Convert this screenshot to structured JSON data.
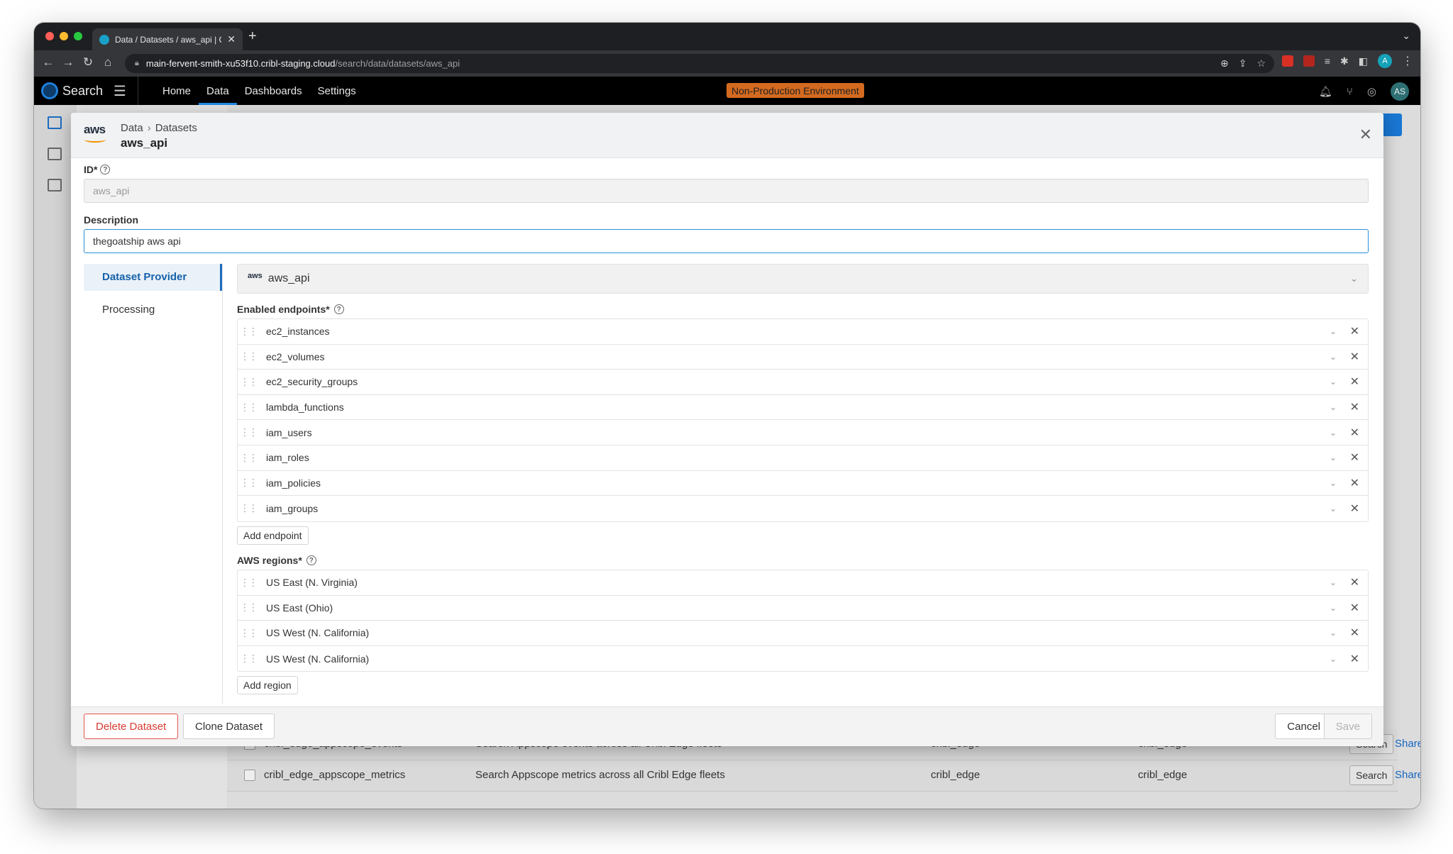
{
  "browser": {
    "tab_title": "Data / Datasets / aws_api | Cribl",
    "url_host": "main-fervent-smith-xu53f10.cribl-staging.cloud",
    "url_path": "/search/data/datasets/aws_api",
    "profile_initial": "A"
  },
  "app": {
    "name": "Search",
    "nav": [
      "Home",
      "Data",
      "Dashboards",
      "Settings"
    ],
    "active_nav": "Data",
    "env_badge": "Non-Production Environment",
    "user_initials": "AS"
  },
  "background_rows": [
    {
      "name": "cribl_edge_appscope_events",
      "description": "Search Appscope events across all Cribl Edge fleets",
      "provider": "cribl_edge",
      "type": "cribl_edge",
      "action": "Search",
      "share": "Share"
    },
    {
      "name": "cribl_edge_appscope_metrics",
      "description": "Search Appscope metrics across all Cribl Edge fleets",
      "provider": "cribl_edge",
      "type": "cribl_edge",
      "action": "Search",
      "share": "Share"
    }
  ],
  "modal": {
    "provider_logo": "aws",
    "breadcrumb": [
      "Data",
      "Datasets"
    ],
    "title": "aws_api",
    "id_label": "ID*",
    "id_value": "aws_api",
    "description_label": "Description",
    "description_value": "thegoatship aws api",
    "side_nav": [
      "Dataset Provider",
      "Processing"
    ],
    "provider": {
      "logo": "aws",
      "name": "aws_api"
    },
    "endpoints_label": "Enabled endpoints*",
    "endpoints": [
      "ec2_instances",
      "ec2_volumes",
      "ec2_security_groups",
      "lambda_functions",
      "iam_users",
      "iam_roles",
      "iam_policies",
      "iam_groups"
    ],
    "add_endpoint": "Add endpoint",
    "regions_label": "AWS regions*",
    "regions": [
      "US East (N. Virginia)",
      "US East (Ohio)",
      "US West (N. California)",
      "US West (N. California)"
    ],
    "add_region": "Add region",
    "footer": {
      "delete": "Delete Dataset",
      "clone": "Clone Dataset",
      "cancel": "Cancel",
      "save": "Save"
    }
  },
  "colors": {
    "accent": "#1b6dc0",
    "env_badge": "#d46a1f",
    "danger": "#d93a31"
  }
}
